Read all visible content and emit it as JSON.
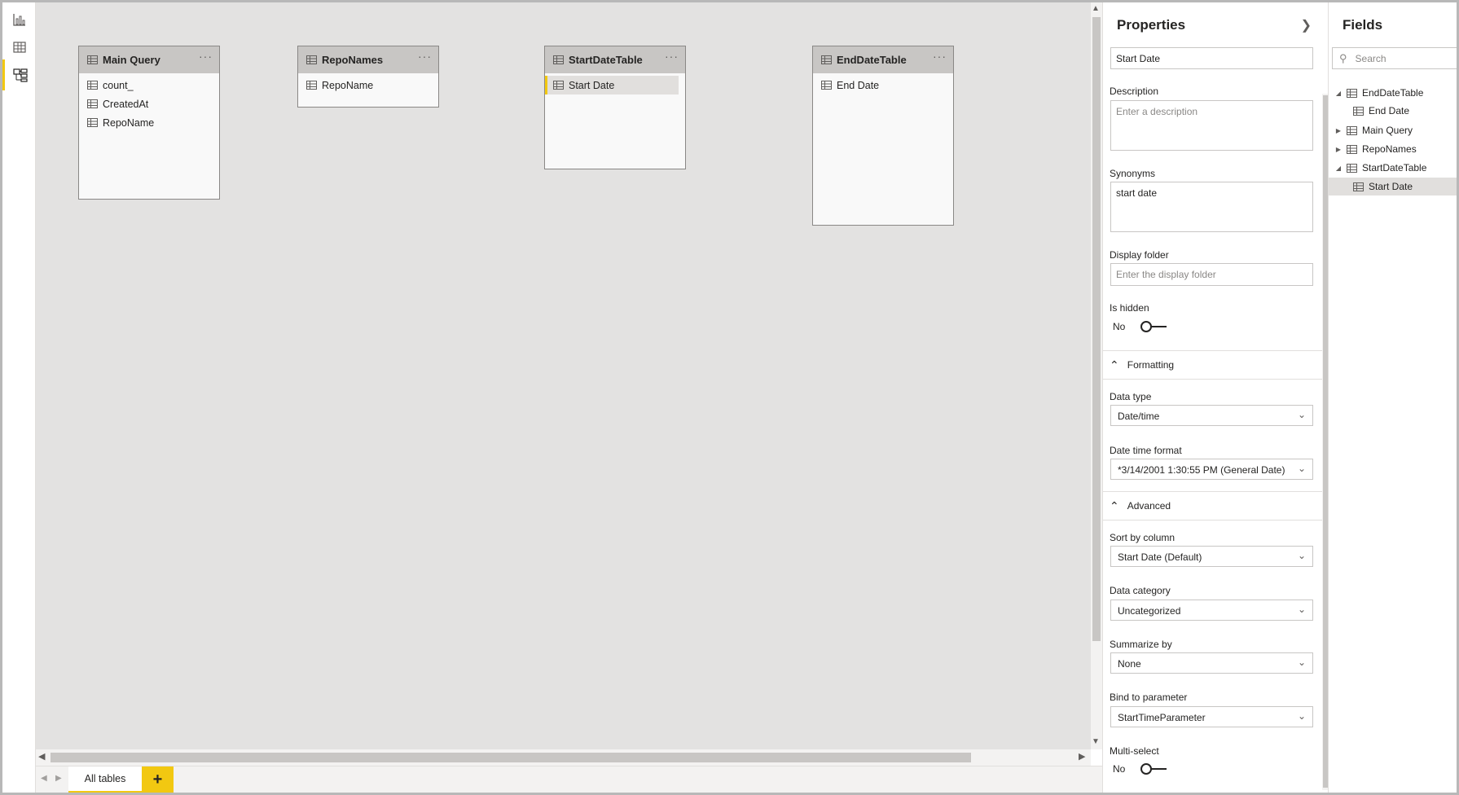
{
  "rail": {
    "items": [
      {
        "name": "report-view",
        "icon": "bar-chart-icon"
      },
      {
        "name": "data-view",
        "icon": "table-grid-icon"
      },
      {
        "name": "model-view",
        "icon": "model-icon",
        "active": true
      }
    ]
  },
  "canvas": {
    "tables": [
      {
        "title": "Main Query",
        "columns": [
          "count_",
          "CreatedAt",
          "RepoName"
        ]
      },
      {
        "title": "RepoNames",
        "columns": [
          "RepoName"
        ]
      },
      {
        "title": "StartDateTable",
        "columns": [
          "Start Date"
        ],
        "selected_column": "Start Date"
      },
      {
        "title": "EndDateTable",
        "columns": [
          "End Date"
        ]
      }
    ],
    "more_glyph": "···"
  },
  "tabs": {
    "active": "All tables",
    "add": "+"
  },
  "properties": {
    "title": "Properties",
    "name_value": "Start Date",
    "description_label": "Description",
    "description_placeholder": "Enter a description",
    "synonyms_label": "Synonyms",
    "synonyms_value": "start date",
    "display_folder_label": "Display folder",
    "display_folder_placeholder": "Enter the display folder",
    "is_hidden_label": "Is hidden",
    "is_hidden_value": "No",
    "formatting_label": "Formatting",
    "data_type_label": "Data type",
    "data_type_value": "Date/time",
    "date_time_format_label": "Date time format",
    "date_time_format_value": "*3/14/2001 1:30:55 PM (General Date)",
    "advanced_label": "Advanced",
    "sort_by_label": "Sort by column",
    "sort_by_value": "Start Date (Default)",
    "data_category_label": "Data category",
    "data_category_value": "Uncategorized",
    "summarize_label": "Summarize by",
    "summarize_value": "None",
    "bind_label": "Bind to parameter",
    "bind_value": "StartTimeParameter",
    "multi_select_label": "Multi-select",
    "multi_select_value": "No"
  },
  "fields": {
    "title": "Fields",
    "search_placeholder": "Search",
    "tree": [
      {
        "label": "EndDateTable",
        "expanded": true
      },
      {
        "label": "End Date",
        "child": true
      },
      {
        "label": "Main Query",
        "expanded": false
      },
      {
        "label": "RepoNames",
        "expanded": false
      },
      {
        "label": "StartDateTable",
        "expanded": true
      },
      {
        "label": "Start Date",
        "child": true,
        "selected": true
      }
    ]
  },
  "colors": {
    "accent": "#f2c811",
    "canvas": "#e3e2e1",
    "card_header": "#c8c6c4"
  }
}
